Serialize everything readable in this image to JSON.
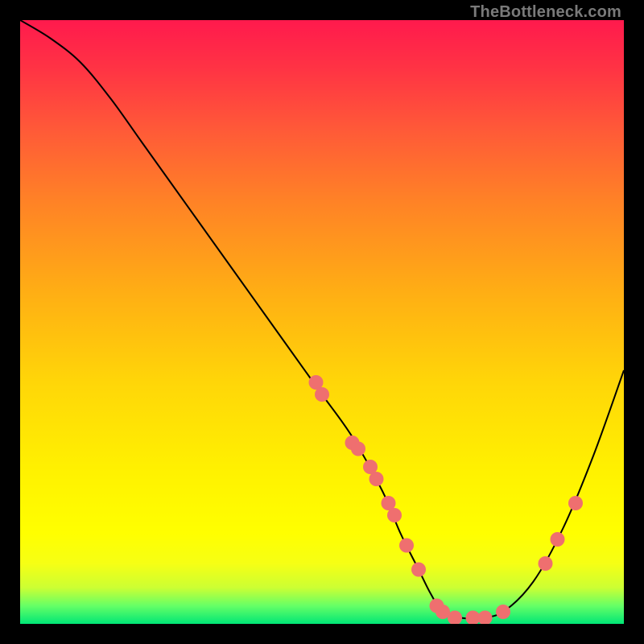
{
  "watermark": "TheBottleneck.com",
  "chart_data": {
    "type": "line",
    "title": "",
    "xlabel": "",
    "ylabel": "",
    "xlim": [
      0,
      1
    ],
    "ylim": [
      0,
      1
    ],
    "series": [
      {
        "name": "curve",
        "x": [
          0.0,
          0.05,
          0.1,
          0.15,
          0.2,
          0.25,
          0.3,
          0.35,
          0.4,
          0.45,
          0.5,
          0.55,
          0.6,
          0.63,
          0.66,
          0.68,
          0.7,
          0.73,
          0.76,
          0.8,
          0.85,
          0.9,
          0.95,
          1.0
        ],
        "y": [
          1.0,
          0.97,
          0.93,
          0.87,
          0.8,
          0.73,
          0.66,
          0.59,
          0.52,
          0.45,
          0.38,
          0.31,
          0.22,
          0.15,
          0.09,
          0.05,
          0.02,
          0.01,
          0.01,
          0.02,
          0.07,
          0.16,
          0.28,
          0.42
        ]
      }
    ],
    "scatter_points": [
      {
        "x": 0.49,
        "y": 0.4
      },
      {
        "x": 0.5,
        "y": 0.38
      },
      {
        "x": 0.55,
        "y": 0.3
      },
      {
        "x": 0.56,
        "y": 0.29
      },
      {
        "x": 0.58,
        "y": 0.26
      },
      {
        "x": 0.59,
        "y": 0.24
      },
      {
        "x": 0.61,
        "y": 0.2
      },
      {
        "x": 0.62,
        "y": 0.18
      },
      {
        "x": 0.64,
        "y": 0.13
      },
      {
        "x": 0.66,
        "y": 0.09
      },
      {
        "x": 0.69,
        "y": 0.03
      },
      {
        "x": 0.7,
        "y": 0.02
      },
      {
        "x": 0.72,
        "y": 0.01
      },
      {
        "x": 0.75,
        "y": 0.01
      },
      {
        "x": 0.77,
        "y": 0.01
      },
      {
        "x": 0.8,
        "y": 0.02
      },
      {
        "x": 0.87,
        "y": 0.1
      },
      {
        "x": 0.89,
        "y": 0.14
      },
      {
        "x": 0.92,
        "y": 0.2
      }
    ],
    "colors": {
      "curve_stroke": "#000000",
      "point_fill": "#ef6f6f",
      "gradient_top": "#ff1a4d",
      "gradient_bottom": "#00e676"
    }
  }
}
